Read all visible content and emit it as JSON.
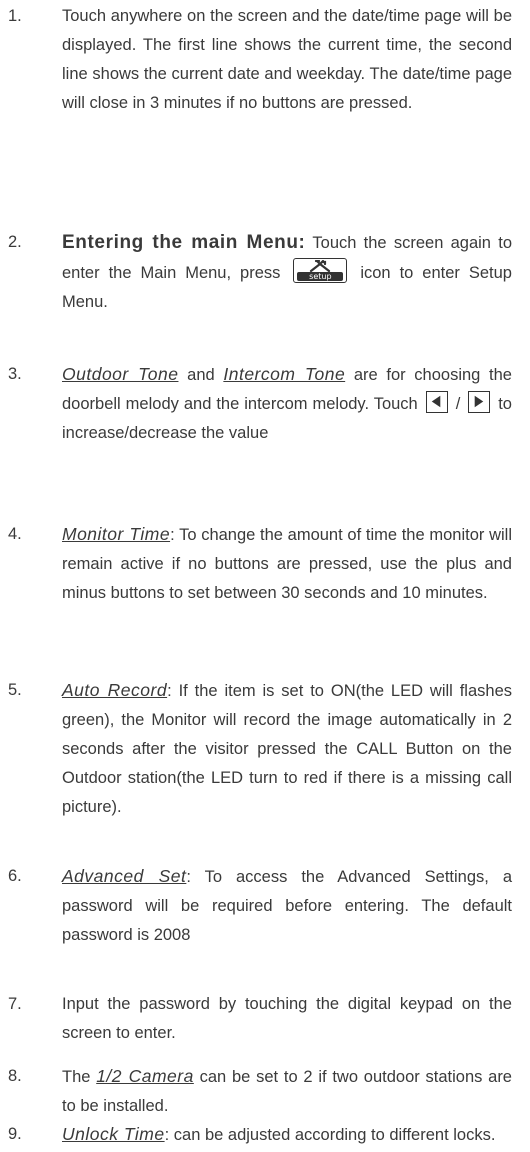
{
  "items": [
    {
      "num": "1.",
      "text": "Touch anywhere on the screen and the date/time page will be displayed. The first line shows the current time, the second line shows the current date and weekday. The date/time page will close in 3 minutes if no buttons are pressed."
    },
    {
      "num": "2.",
      "heading": "Entering the main Menu:",
      "text_a": " Touch the screen again to enter the Main Menu, press ",
      "icon_label": "setup",
      "icon_name": "setup-tools-icon",
      "text_b": " icon to enter Setup Menu."
    },
    {
      "num": "3.",
      "term1": "Outdoor Tone",
      "text_a": "  and ",
      "term2": "Intercom Tone",
      "text_b": " are for choosing the doorbell melody and the intercom melody. Touch ",
      "slash": " / ",
      "text_c": " to increase/decrease the value",
      "left_icon": "triangle-left-icon",
      "right_icon": "triangle-right-icon"
    },
    {
      "num": "4.",
      "term": "Monitor Time",
      "text": ":  To change the amount of time the monitor will remain active if no buttons are pressed, use the plus and minus buttons to set between 30 seconds and 10 minutes."
    },
    {
      "num": "5.",
      "term": "Auto Record",
      "text": ": If the item is set to ON(the LED will flashes green), the Monitor will record the image automatically in 2 seconds after the visitor pressed the CALL Button on the Outdoor station(the LED turn to red if there is a missing call picture)."
    },
    {
      "num": "6.",
      "term": "Advanced Set",
      "text": ": To access the Advanced Settings, a password will be required before entering. The default password is 2008"
    },
    {
      "num": "7.",
      "text": "Input the password by touching the digital keypad on the screen to enter."
    },
    {
      "num": "8.",
      "text_a": "The ",
      "term": "1/2 Camera",
      "text_b": " can be set to 2 if two outdoor stations are to be installed."
    },
    {
      "num": "9.",
      "term": "Unlock Time",
      "text": ": can be adjusted according to different locks."
    }
  ]
}
